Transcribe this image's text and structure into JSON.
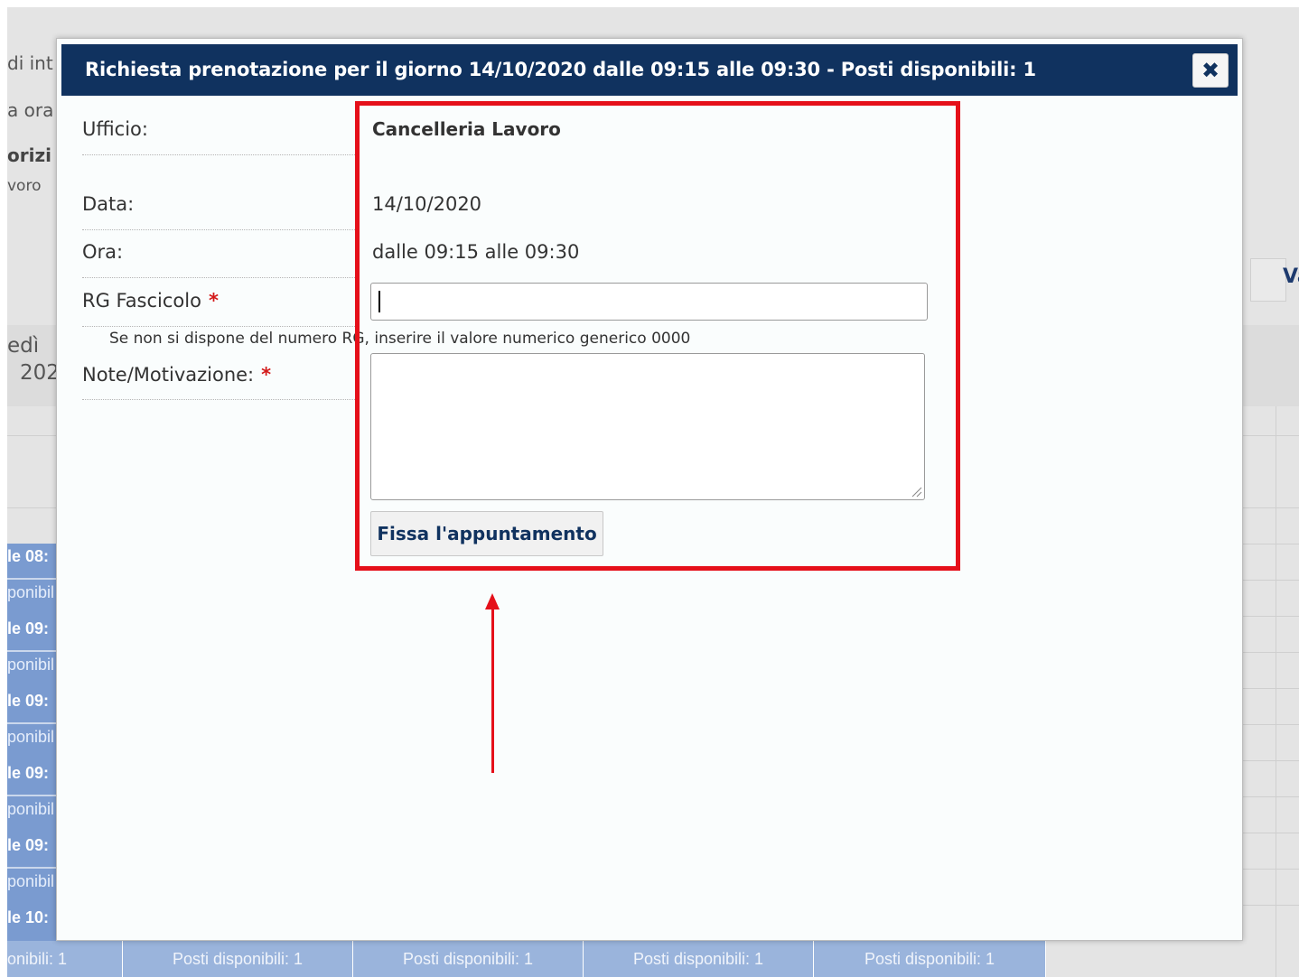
{
  "background": {
    "fragments": [
      "di int",
      "a ora",
      "orizi",
      "voro",
      "edì",
      "202"
    ],
    "right_button_text": "Va",
    "slots": [
      {
        "time": "le 08:",
        "avail": "ponibil"
      },
      {
        "time": "le 09:",
        "avail": "ponibil"
      },
      {
        "time": "le 09:",
        "avail": "ponibil"
      },
      {
        "time": "le 09:",
        "avail": "ponibil"
      },
      {
        "time": "le 09:",
        "avail": "ponibil"
      },
      {
        "time": "le 10:",
        "avail": ""
      }
    ],
    "bottom_cells": [
      "onibili: 1",
      "Posti disponibili: 1",
      "Posti disponibili: 1",
      "Posti disponibili: 1",
      "Posti disponibili: 1"
    ]
  },
  "modal": {
    "title": "Richiesta prenotazione per il giorno 14/10/2020 dalle 09:15 alle 09:30 - Posti disponibili: 1",
    "close_icon": "✖",
    "fields": {
      "ufficio_label": "Ufficio:",
      "ufficio_value": "Cancelleria Lavoro",
      "data_label": "Data:",
      "data_value": "14/10/2020",
      "ora_label": "Ora:",
      "ora_value": "dalle 09:15 alle 09:30",
      "rg_label": "RG Fascicolo",
      "rg_value": "",
      "rg_hint": "Se non si dispone del numero RG, inserire il valore numerico generico 0000",
      "note_label": "Note/Motivazione:",
      "note_value": "",
      "required_mark": "*"
    },
    "submit_label": "Fissa l'appuntamento"
  },
  "colors": {
    "header_bg": "#10325f",
    "highlight": "#e5101a",
    "slot_bg": "#7a9bd0"
  }
}
